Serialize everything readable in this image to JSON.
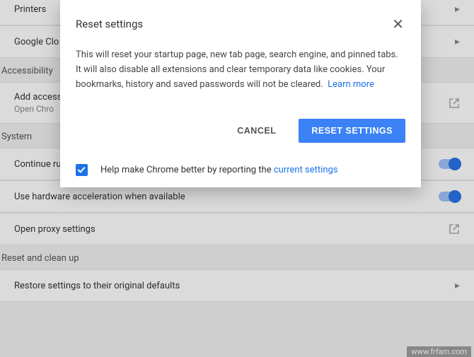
{
  "dialog": {
    "title": "Reset settings",
    "body": "This will reset your startup page, new tab page, search engine, and pinned tabs. It will also disable all extensions and clear temporary data like cookies. Your bookmarks, history and saved passwords will not be cleared.",
    "learn_more": "Learn more",
    "cancel": "CANCEL",
    "confirm": "RESET SETTINGS",
    "checkbox_checked": true,
    "footer_prefix": "Help make Chrome better by reporting the ",
    "footer_link": "current settings"
  },
  "sections": {
    "printing": {
      "printers": "Printers",
      "cloud": "Google Clo"
    },
    "accessibility_header": "Accessibility",
    "accessibility": {
      "title": "Add access",
      "sub": "Open Chro"
    },
    "system_header": "System",
    "system": {
      "bg_apps": "Continue running background apps when Google Chrome is closed",
      "hw_accel": "Use hardware acceleration when available",
      "proxy": "Open proxy settings"
    },
    "reset_header": "Reset and clean up",
    "reset": {
      "restore": "Restore settings to their original defaults"
    }
  },
  "watermark": "www.frfam.com"
}
